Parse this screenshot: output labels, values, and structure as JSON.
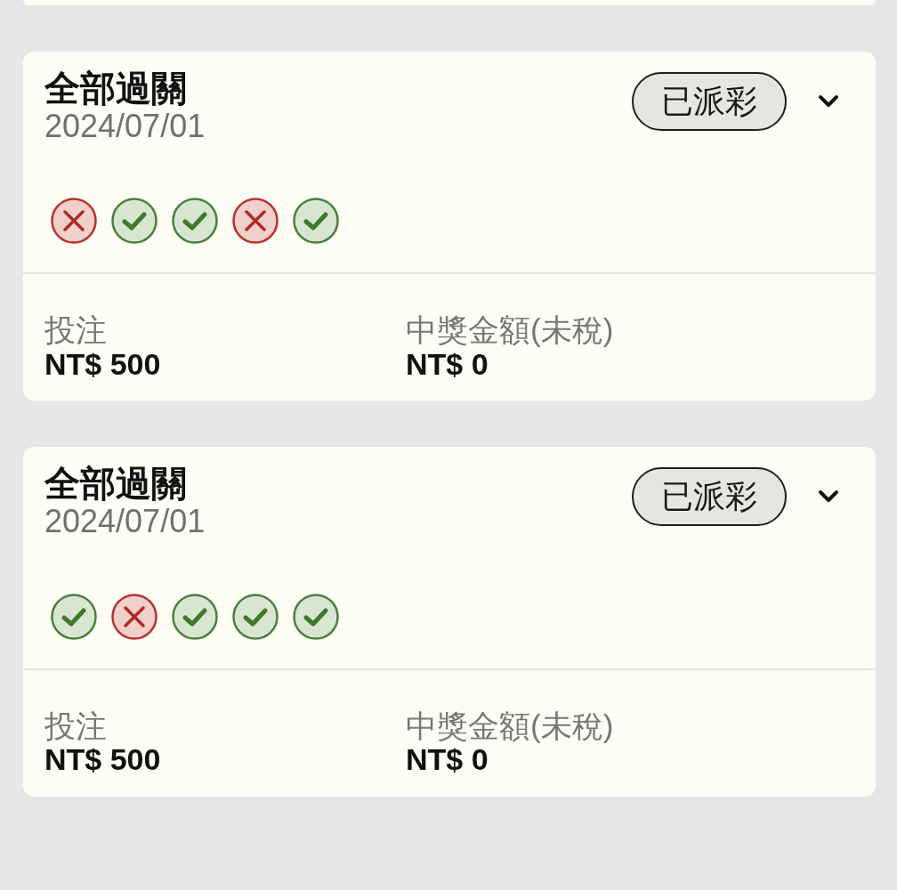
{
  "bets": [
    {
      "title": "全部過關",
      "date": "2024/07/01",
      "status": "已派彩",
      "expanded": false,
      "legs": [
        {
          "kind": "lost"
        },
        {
          "kind": "won"
        },
        {
          "kind": "won"
        },
        {
          "kind": "lost"
        },
        {
          "kind": "won"
        }
      ],
      "stake": {
        "label": "投注",
        "value": "NT$ 500"
      },
      "payout": {
        "label": "中獎金額(未稅)",
        "value": "NT$ 0"
      }
    },
    {
      "title": "全部過關",
      "date": "2024/07/01",
      "status": "已派彩",
      "expanded": false,
      "legs": [
        {
          "kind": "won"
        },
        {
          "kind": "lost"
        },
        {
          "kind": "won"
        },
        {
          "kind": "won"
        },
        {
          "kind": "won"
        }
      ],
      "stake": {
        "label": "投注",
        "value": "NT$ 500"
      },
      "payout": {
        "label": "中獎金額(未稅)",
        "value": "NT$ 0"
      }
    }
  ]
}
